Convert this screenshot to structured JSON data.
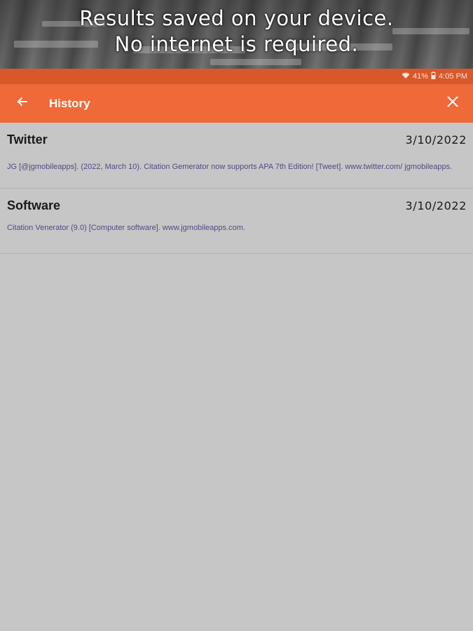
{
  "promo": {
    "line1": "Results saved on your device.",
    "line2": "No internet is required."
  },
  "status_bar": {
    "wifi_icon": "wifi-icon",
    "battery": "41%",
    "battery_icon": "battery-icon",
    "time": "4:05 PM"
  },
  "app_bar": {
    "back_icon": "arrow-left-icon",
    "title": "History",
    "close_icon": "close-icon",
    "color": "#ef6939"
  },
  "history": [
    {
      "title": "Twitter",
      "date": "3/10/2022",
      "citation": "JG [@jgmobileapps]. (2022, March 10). Citation Gemerator now supports APA 7th Edition! [Tweet]. www.twitter.com/ jgmobileapps."
    },
    {
      "title": "Software",
      "date": "3/10/2022",
      "citation": "Citation Venerator (9.0) [Computer software]. www.jgmobileapps.com."
    }
  ]
}
